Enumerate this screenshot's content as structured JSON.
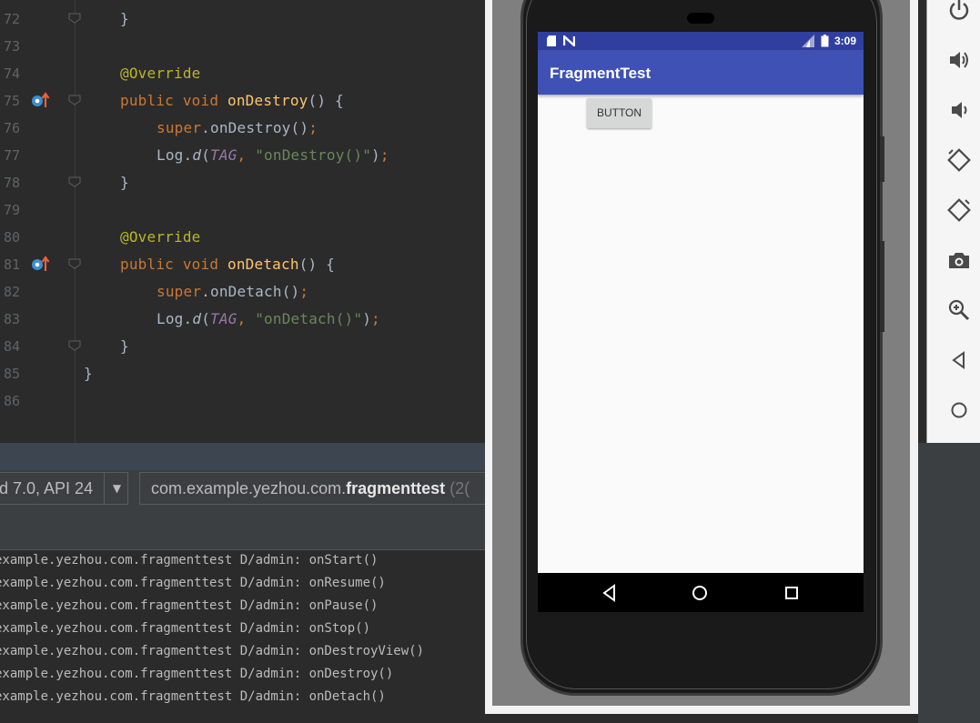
{
  "editor": {
    "lines": [
      {
        "num": "72",
        "indent": 1,
        "fold": true,
        "parts": [
          [
            "plain",
            "}"
          ]
        ]
      },
      {
        "num": "73",
        "indent": 0,
        "parts": []
      },
      {
        "num": "74",
        "indent": 1,
        "parts": [
          [
            "ann",
            "@Override"
          ]
        ]
      },
      {
        "num": "75",
        "indent": 1,
        "marker": true,
        "fold": true,
        "parts": [
          [
            "kw",
            "public void "
          ],
          [
            "fn",
            "onDestroy"
          ],
          [
            "plain",
            "() {"
          ]
        ]
      },
      {
        "num": "76",
        "indent": 2,
        "parts": [
          [
            "kw",
            "super"
          ],
          [
            "plain",
            "."
          ],
          [
            "plain",
            "onDestroy"
          ],
          [
            "plain",
            "()"
          ],
          [
            "kw",
            ";"
          ]
        ]
      },
      {
        "num": "77",
        "indent": 2,
        "parts": [
          [
            "plain",
            "Log."
          ],
          [
            "ital",
            "d"
          ],
          [
            "plain",
            "("
          ],
          [
            "tag",
            "TAG"
          ],
          [
            "kw",
            ", "
          ],
          [
            "str",
            "\"onDestroy()\""
          ],
          [
            "plain",
            ")"
          ],
          [
            "kw",
            ";"
          ]
        ]
      },
      {
        "num": "78",
        "indent": 1,
        "fold": true,
        "parts": [
          [
            "plain",
            "}"
          ]
        ]
      },
      {
        "num": "79",
        "indent": 0,
        "parts": []
      },
      {
        "num": "80",
        "indent": 1,
        "parts": [
          [
            "ann",
            "@Override"
          ]
        ]
      },
      {
        "num": "81",
        "indent": 1,
        "marker": true,
        "fold": true,
        "parts": [
          [
            "kw",
            "public void "
          ],
          [
            "fn",
            "onDetach"
          ],
          [
            "plain",
            "() {"
          ]
        ]
      },
      {
        "num": "82",
        "indent": 2,
        "parts": [
          [
            "kw",
            "super"
          ],
          [
            "plain",
            "."
          ],
          [
            "plain",
            "onDetach"
          ],
          [
            "plain",
            "()"
          ],
          [
            "kw",
            ";"
          ]
        ]
      },
      {
        "num": "83",
        "indent": 2,
        "parts": [
          [
            "plain",
            "Log."
          ],
          [
            "ital",
            "d"
          ],
          [
            "plain",
            "("
          ],
          [
            "tag",
            "TAG"
          ],
          [
            "kw",
            ", "
          ],
          [
            "str",
            "\"onDetach()\""
          ],
          [
            "plain",
            ")"
          ],
          [
            "kw",
            ";"
          ]
        ]
      },
      {
        "num": "84",
        "indent": 1,
        "fold": true,
        "parts": [
          [
            "plain",
            "}"
          ]
        ]
      },
      {
        "num": "85",
        "indent": 0,
        "parts": [
          [
            "plain",
            "}"
          ]
        ]
      },
      {
        "num": "86",
        "indent": 0,
        "parts": []
      }
    ]
  },
  "logcat_toolbar": {
    "device": "d 7.0, API 24",
    "dropdown_arrow": "▼",
    "process_prefix": "com.example.yezhou.com.",
    "process_bold": "fragmenttest",
    "process_suffix": " (2("
  },
  "logcat": {
    "lines": [
      "example.yezhou.com.fragmenttest D/admin: onStart()",
      "example.yezhou.com.fragmenttest D/admin: onResume()",
      "example.yezhou.com.fragmenttest D/admin: onPause()",
      "example.yezhou.com.fragmenttest D/admin: onStop()",
      "example.yezhou.com.fragmenttest D/admin: onDestroyView()",
      "example.yezhou.com.fragmenttest D/admin: onDestroy()",
      "example.yezhou.com.fragmenttest D/admin: onDetach()"
    ]
  },
  "phone": {
    "status_time": "3:09",
    "app_title": "FragmentTest",
    "button_label": "BUTTON",
    "colors": {
      "primary": "#3f51b5",
      "primary_dark": "#303f9f"
    }
  },
  "emulator_toolbar": {
    "icons": [
      "power-icon",
      "volume-up-icon",
      "volume-down-icon",
      "rotate-left-icon",
      "rotate-right-icon",
      "camera-icon",
      "zoom-icon",
      "back-icon",
      "home-icon",
      "overview-icon",
      "more-icon"
    ]
  }
}
